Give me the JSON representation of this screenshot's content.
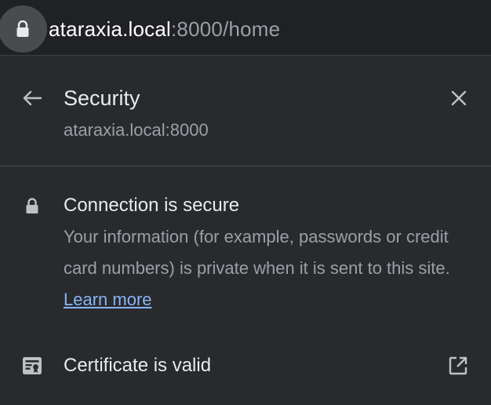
{
  "address_bar": {
    "host": "ataraxia.local",
    "rest": ":8000/home",
    "icon": "lock-icon"
  },
  "panel": {
    "title": "Security",
    "subtitle": "ataraxia.local:8000",
    "back_icon": "back-arrow-icon",
    "close_icon": "close-icon"
  },
  "connection": {
    "icon": "lock-icon",
    "title": "Connection is secure",
    "description": "Your information (for example, passwords or credit card numbers) is private when it is sent to this site.",
    "link": "Learn more"
  },
  "certificate": {
    "icon": "certificate-icon",
    "label": "Certificate is valid",
    "external_icon": "external-link-icon"
  },
  "colors": {
    "background": "#292a2d",
    "address_bar": "#202124",
    "primary_text": "#e8eaed",
    "secondary_text": "#9aa0a6",
    "link": "#8ab4f8"
  }
}
